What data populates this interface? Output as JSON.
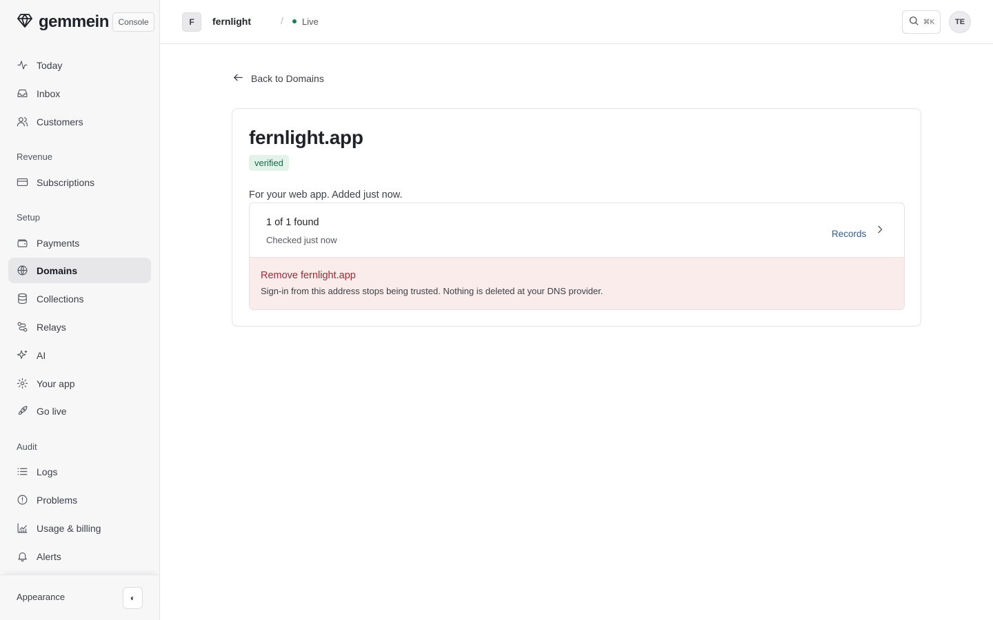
{
  "brand": {
    "name": "gemmein",
    "console_label": "Console"
  },
  "sidebar": {
    "items_top": [
      {
        "label": "Today",
        "icon": "activity-icon"
      },
      {
        "label": "Inbox",
        "icon": "inbox-icon"
      },
      {
        "label": "Customers",
        "icon": "users-icon"
      }
    ],
    "sections": [
      {
        "label": "Revenue",
        "items": [
          {
            "label": "Subscriptions",
            "icon": "credit-card-icon"
          }
        ]
      },
      {
        "label": "Setup",
        "items": [
          {
            "label": "Payments",
            "icon": "wallet-icon"
          },
          {
            "label": "Domains",
            "icon": "globe-icon",
            "active": true
          },
          {
            "label": "Collections",
            "icon": "database-icon"
          },
          {
            "label": "Relays",
            "icon": "route-icon"
          },
          {
            "label": "AI",
            "icon": "sparkles-icon"
          },
          {
            "label": "Your app",
            "icon": "gear-icon"
          },
          {
            "label": "Go live",
            "icon": "rocket-icon"
          }
        ]
      },
      {
        "label": "Audit",
        "items": [
          {
            "label": "Logs",
            "icon": "list-icon"
          },
          {
            "label": "Problems",
            "icon": "alert-circle-icon"
          },
          {
            "label": "Usage & billing",
            "icon": "chart-icon"
          },
          {
            "label": "Alerts",
            "icon": "bell-icon"
          }
        ]
      }
    ],
    "footer": {
      "appearance_label": "Appearance",
      "toggle_glyph": "◐"
    }
  },
  "topbar": {
    "project_initial": "F",
    "project_name": "fernlight",
    "separator": "/",
    "environment": "Live",
    "environment_color": "#17805a",
    "search_shortcut": "⌘K",
    "user_initials": "TE"
  },
  "main": {
    "back_label": "Back to Domains",
    "domain": {
      "name": "fernlight.app",
      "status": "verified",
      "description": "For your web app. Added just now.",
      "records_found": "1 of 1 found",
      "checked": "Checked just now",
      "records_link": "Records",
      "remove_title": "Remove fernlight.app",
      "remove_description": "Sign-in from this address stops being trusted. Nothing is deleted at your DNS provider."
    }
  },
  "colors": {
    "accent_link": "#2f5d9a",
    "danger": "#a52834",
    "success_badge_bg": "#e4f3ea",
    "success_badge_text": "#17694a"
  }
}
